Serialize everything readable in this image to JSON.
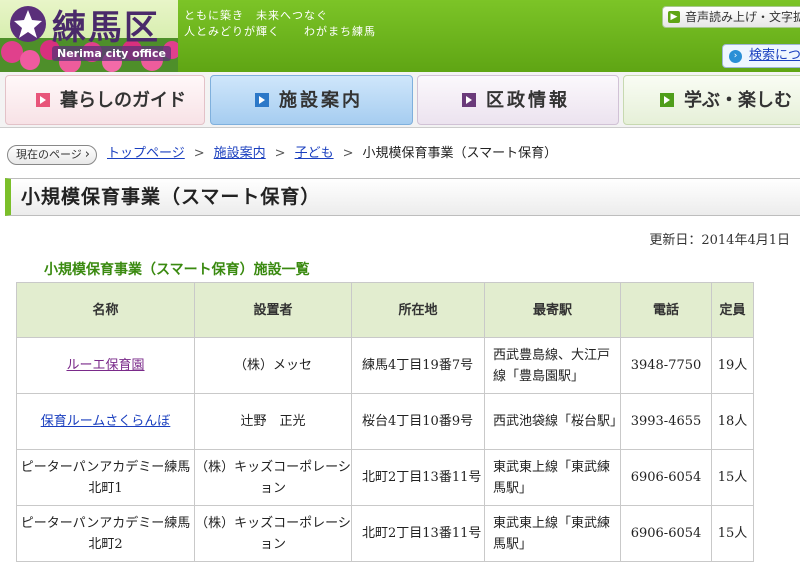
{
  "header": {
    "logo_title": "練馬区",
    "logo_sub": "Nerima city office",
    "slogan_line1": "ともに築き　未来へつなぐ",
    "slogan_line2": "人とみどりが輝く　　わがまち練馬",
    "tool_label": "音声読み上げ・文字拡大",
    "search_label": "検索について"
  },
  "nav": [
    {
      "label": "暮らしのガイド"
    },
    {
      "label": "施設案内"
    },
    {
      "label": "区政情報"
    },
    {
      "label": "学ぶ・楽しむ"
    }
  ],
  "breadcrumb": {
    "label": "現在のページ",
    "items": [
      "トップページ",
      "施設案内",
      "子ども"
    ],
    "current": "小規模保育事業（スマート保育）"
  },
  "page": {
    "title": "小規模保育事業（スマート保育）",
    "updated": "更新日：2014年4月1日",
    "table_caption": "小規模保育事業（スマート保育）施設一覧"
  },
  "table": {
    "headers": [
      "名称",
      "設置者",
      "所在地",
      "最寄駅",
      "電話",
      "定員"
    ],
    "rows": [
      {
        "name": "ルーエ保育園",
        "owner": "（株）メッセ",
        "address": "練馬4丁目19番7号",
        "station": "西武豊島線、大江戸線「豊島園駅」",
        "phone": "3948-7750",
        "capacity": "19人"
      },
      {
        "name": "保育ルームさくらんぼ",
        "owner": "辻野　正光",
        "address": "桜台4丁目10番9号",
        "station": "西武池袋線「桜台駅」",
        "phone": "3993-4655",
        "capacity": "18人"
      },
      {
        "name": "ピーターパンアカデミー練馬北町1",
        "owner": "（株）キッズコーポレーション",
        "address": "北町2丁目13番11号",
        "station": "東武東上線「東武練馬駅」",
        "phone": "6906-6054",
        "capacity": "15人"
      },
      {
        "name": "ピーターパンアカデミー練馬北町2",
        "owner": "（株）キッズコーポレーション",
        "address": "北町2丁目13番11号",
        "station": "東武東上線「東武練馬駅」",
        "phone": "6906-6054",
        "capacity": "15人"
      }
    ]
  },
  "colors": {
    "header_green": "#6cb41c",
    "nav_active": "#a6cdf0",
    "link": "#1a3fbf",
    "visited_link": "#7a2a8a",
    "caption_green": "#3a8a10",
    "table_header_bg": "#e2edcf"
  },
  "icons": {
    "emblem": "nerima-emblem-icon",
    "tool": "speaker-icon",
    "search": "info-icon"
  }
}
